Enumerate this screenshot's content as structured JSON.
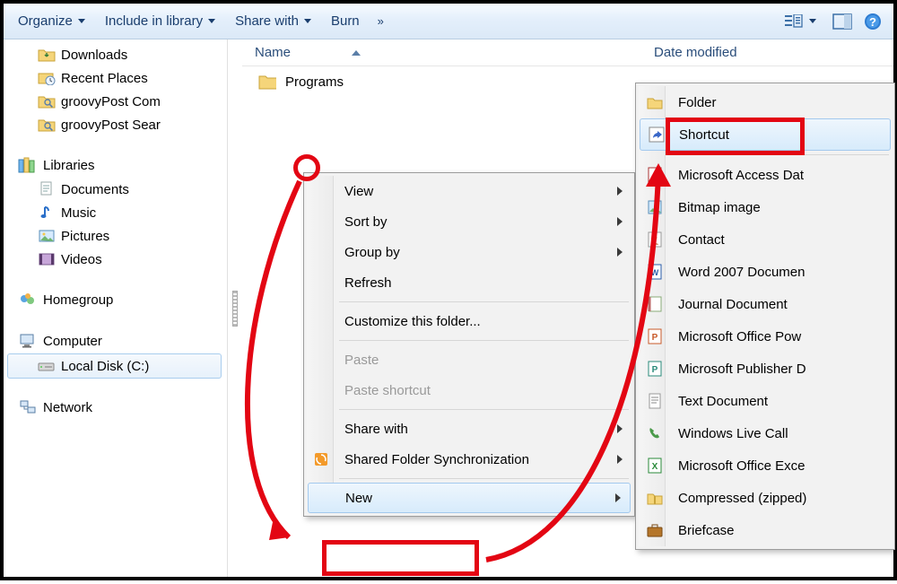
{
  "toolbar": {
    "organize": "Organize",
    "include": "Include in library",
    "share": "Share with",
    "burn": "Burn"
  },
  "columns": {
    "name": "Name",
    "date_modified": "Date modified"
  },
  "files": [
    {
      "name": "Programs"
    }
  ],
  "sidebar": {
    "favorites": [
      {
        "label": "Downloads"
      },
      {
        "label": "Recent Places"
      },
      {
        "label": "groovyPost Com"
      },
      {
        "label": "groovyPost Sear"
      }
    ],
    "libraries_header": "Libraries",
    "libraries": [
      {
        "label": "Documents"
      },
      {
        "label": "Music"
      },
      {
        "label": "Pictures"
      },
      {
        "label": "Videos"
      }
    ],
    "homegroup": "Homegroup",
    "computer_header": "Computer",
    "computer": [
      {
        "label": "Local Disk (C:)"
      }
    ],
    "network": "Network"
  },
  "context_menu": {
    "view": "View",
    "sort_by": "Sort by",
    "group_by": "Group by",
    "refresh": "Refresh",
    "customize": "Customize this folder...",
    "paste": "Paste",
    "paste_shortcut": "Paste shortcut",
    "share_with": "Share with",
    "shared_folder_sync": "Shared Folder Synchronization",
    "new": "New"
  },
  "new_submenu": {
    "folder": "Folder",
    "shortcut": "Shortcut",
    "access": "Microsoft Access Dat",
    "bitmap": "Bitmap image",
    "contact": "Contact",
    "word": "Word 2007 Documen",
    "journal": "Journal Document",
    "powerpoint": "Microsoft Office Pow",
    "publisher": "Microsoft Publisher D",
    "text": "Text Document",
    "live_call": "Windows Live Call",
    "excel": "Microsoft Office Exce",
    "compressed": "Compressed (zipped)",
    "briefcase": "Briefcase"
  }
}
